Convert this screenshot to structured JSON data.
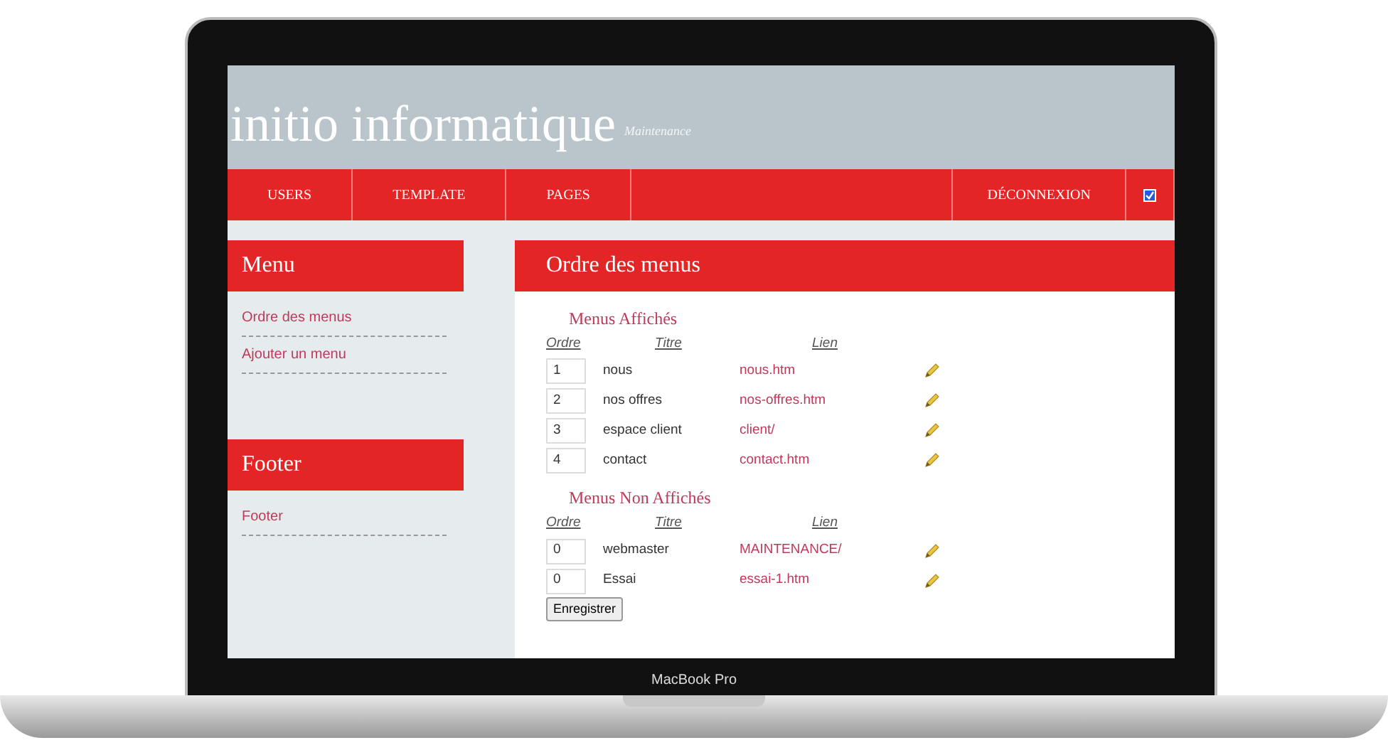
{
  "header": {
    "title": "initio informatique",
    "subtitle": "Maintenance"
  },
  "nav": {
    "items": [
      {
        "label": "USERS"
      },
      {
        "label": "TEMPLATE"
      },
      {
        "label": "PAGES"
      }
    ],
    "logout": "DÉCONNEXION",
    "checkbox_checked": true
  },
  "sidebar": [
    {
      "title": "Menu",
      "links": [
        "Ordre des menus",
        "Ajouter un menu"
      ]
    },
    {
      "title": "Footer",
      "links": [
        "Footer"
      ]
    }
  ],
  "main": {
    "title": "Ordre des menus",
    "sections": [
      {
        "title": "Menus Affichés",
        "columns": [
          "Ordre",
          "Titre",
          "Lien"
        ],
        "rows": [
          {
            "order": "1",
            "title": "nous",
            "link": "nous.htm"
          },
          {
            "order": "2",
            "title": "nos offres",
            "link": "nos-offres.htm"
          },
          {
            "order": "3",
            "title": "espace client",
            "link": "client/"
          },
          {
            "order": "4",
            "title": "contact",
            "link": "contact.htm"
          }
        ]
      },
      {
        "title": "Menus Non Affichés",
        "columns": [
          "Ordre",
          "Titre",
          "Lien"
        ],
        "rows": [
          {
            "order": "0",
            "title": "webmaster",
            "link": "MAINTENANCE/"
          },
          {
            "order": "0",
            "title": "Essai",
            "link": "essai-1.htm"
          }
        ]
      }
    ],
    "save_button": "Enregistrer"
  },
  "device_label": "MacBook Pro"
}
